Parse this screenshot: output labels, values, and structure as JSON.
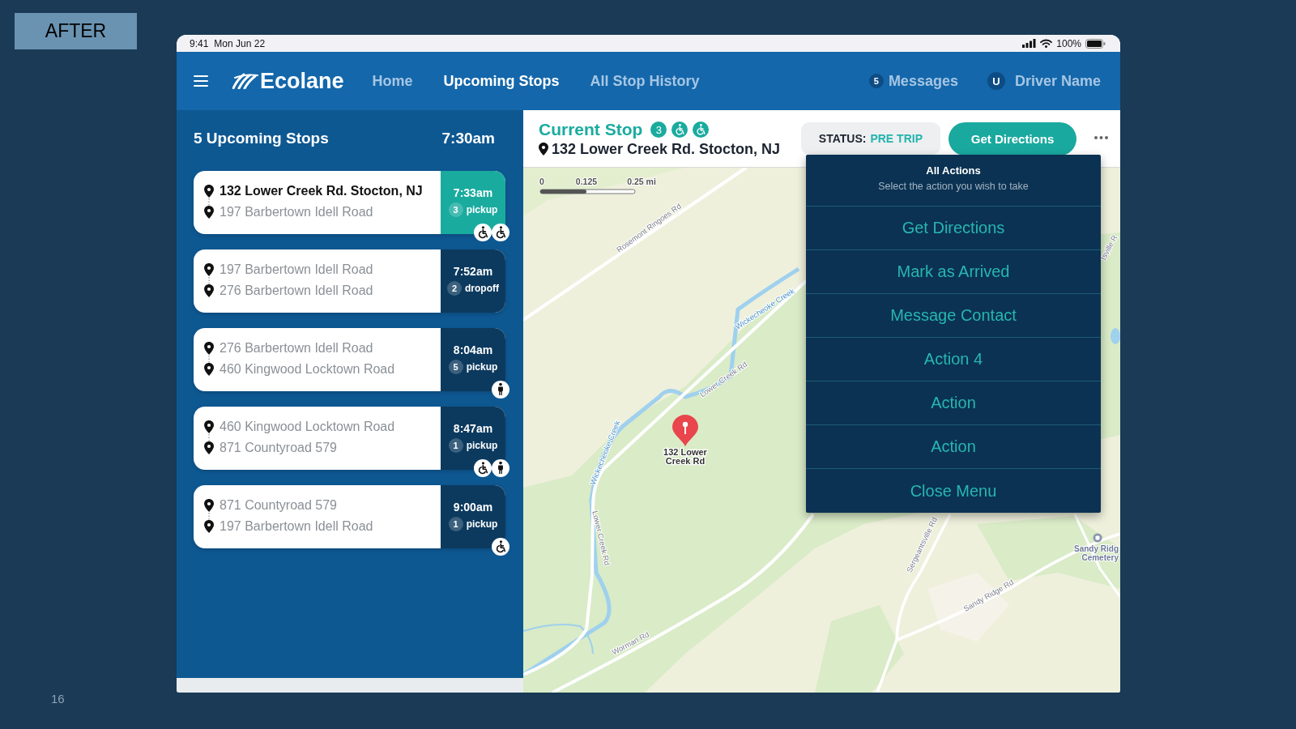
{
  "slide": {
    "label": "AFTER",
    "page_number": "16"
  },
  "status_bar": {
    "time": "9:41",
    "date": "Mon Jun 22",
    "battery": "100%"
  },
  "nav": {
    "logo": "Ecolane",
    "items": [
      {
        "label": "Home",
        "selected": false
      },
      {
        "label": "Upcoming Stops",
        "selected": true
      },
      {
        "label": "All Stop History",
        "selected": false
      }
    ],
    "messages": {
      "count": "5",
      "label": "Messages"
    },
    "user": {
      "initial": "U",
      "name": "Driver Name"
    }
  },
  "stops_panel": {
    "title": "5 Upcoming Stops",
    "time": "7:30am",
    "stops": [
      {
        "from": "132 Lower Creek Rd. Stocton, NJ",
        "to": "197 Barbertown Idell Road",
        "time": "7:33am",
        "count": "3",
        "type": "pickup",
        "mobility": [
          {
            "kind": "wheelchair"
          },
          {
            "kind": "wheelchair"
          }
        ],
        "selected": true
      },
      {
        "from": "197 Barbertown Idell Road",
        "to": "276 Barbertown Idell Road",
        "time": "7:52am",
        "count": "2",
        "type": "dropoff",
        "selected": false
      },
      {
        "from": "276 Barbertown Idell Road",
        "to": "460 Kingwood Locktown Road",
        "time": "8:04am",
        "count": "5",
        "type": "pickup",
        "mobility": [
          {
            "kind": "ambulatory"
          }
        ],
        "selected": false
      },
      {
        "from": "460 Kingwood Locktown Road",
        "to": "871 Countyroad 579",
        "time": "8:47am",
        "count": "1",
        "type": "pickup",
        "mobility": [
          {
            "kind": "wheelchair"
          },
          {
            "kind": "ambulatory"
          }
        ],
        "selected": false
      },
      {
        "from": "871 Countyroad 579",
        "to": "197 Barbertown Idell Road",
        "time": "9:00am",
        "count": "1",
        "type": "pickup",
        "mobility": [
          {
            "kind": "wheelchair"
          }
        ],
        "selected": false
      }
    ]
  },
  "current_stop": {
    "title": "Current Stop",
    "count": "3",
    "mobility": [
      {
        "kind": "wheelchair"
      },
      {
        "kind": "wheelchair"
      }
    ],
    "address": "132 Lower Creek Rd. Stocton, NJ",
    "status": {
      "label": "STATUS:",
      "value": "PRE TRIP"
    },
    "primary_button": "Get Directions"
  },
  "map": {
    "scale": [
      "0",
      "0.125",
      "0.25 mi"
    ],
    "labels": [
      {
        "kind": "road",
        "text": "Rosemont Ringoes Rd"
      },
      {
        "kind": "creek",
        "text": "Wickecheoke Creek"
      },
      {
        "kind": "road",
        "text": "Lower Creek Rd"
      },
      {
        "kind": "creek",
        "text": "Wickecheoke Creek"
      },
      {
        "kind": "road",
        "text": "Lower Creek Rd"
      },
      {
        "kind": "road",
        "text": "Worman Rd"
      },
      {
        "kind": "road",
        "text": "Sergeantsville Rd"
      },
      {
        "kind": "road",
        "text": "Sandy Ridge Rd"
      },
      {
        "kind": "road",
        "text": "tsville R"
      }
    ],
    "pin": {
      "lines": [
        "132 Lower",
        "Creek Rd"
      ]
    },
    "place": {
      "lines": [
        "Sandy Ridg",
        "Cemetery"
      ]
    }
  },
  "actions_menu": {
    "title": "All Actions",
    "subtitle": "Select the action you wish to take",
    "items": [
      "Get Directions",
      "Mark as Arrived",
      "Message Contact",
      "Action 4",
      "Action",
      "Action",
      "Close Menu"
    ]
  }
}
